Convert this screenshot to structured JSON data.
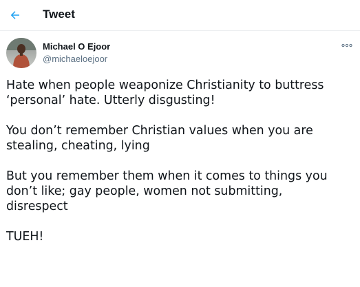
{
  "header": {
    "title": "Tweet",
    "back_icon": "arrow-left-icon"
  },
  "tweet": {
    "author": {
      "name": "Michael O Ejoor",
      "handle": "@michaeloejoor",
      "avatar_icon": "profile-photo"
    },
    "more_icon": "more-dots-icon",
    "paragraphs": [
      "Hate when people weaponize Christianity to buttress\n‘personal’ hate. Utterly disgusting!",
      "You don’t remember Christian values when you are\nstealing, cheating, lying",
      "But you remember them when it comes to things you\ndon’t like; gay people, women not submitting,\ndisrespect",
      "TUEH!"
    ]
  },
  "colors": {
    "accent": "#1da1f2",
    "text": "#0f1419",
    "secondary_text": "#5b7083",
    "divider": "#ebeef0"
  }
}
